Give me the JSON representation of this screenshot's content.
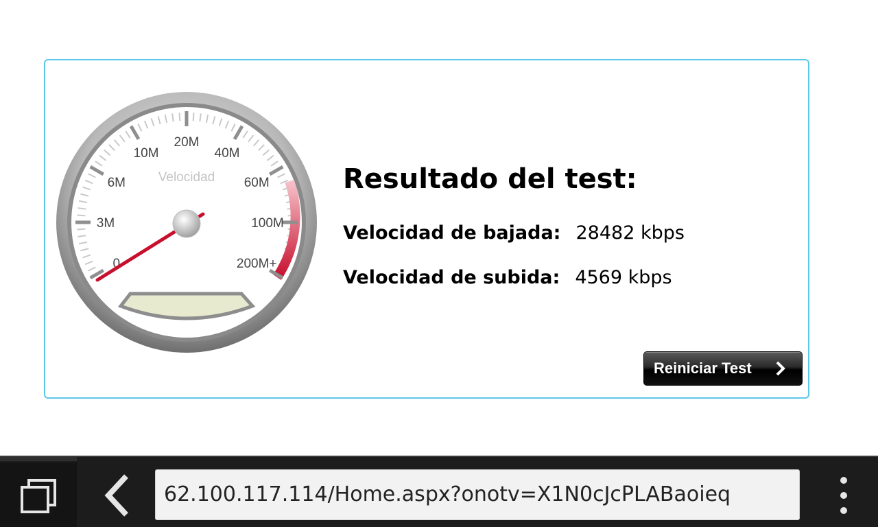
{
  "gauge": {
    "title": "Velocidad",
    "ticks": [
      "0",
      "3M",
      "6M",
      "10M",
      "20M",
      "40M",
      "60M",
      "100M",
      "200M+"
    ],
    "needle_value": "0",
    "colors": {
      "redzone": "#c8102e",
      "needle": "#c8102e",
      "display": "#e8ead0"
    }
  },
  "result": {
    "title": "Resultado del test:",
    "download_label": "Velocidad de bajada:",
    "download_value": "28482 kbps",
    "upload_label": "Velocidad de subida:",
    "upload_value": "4569 kbps",
    "restart_label": "Reiniciar Test"
  },
  "browser": {
    "url": "62.100.117.114/Home.aspx?onotv=X1N0cJcPLABaoieq",
    "icons": [
      "tabs-icon",
      "back-arrow-icon",
      "overflow-menu-icon"
    ]
  },
  "theme": {
    "panel_border": "#5cc8e8",
    "toolbar": "#1c1c1c"
  }
}
